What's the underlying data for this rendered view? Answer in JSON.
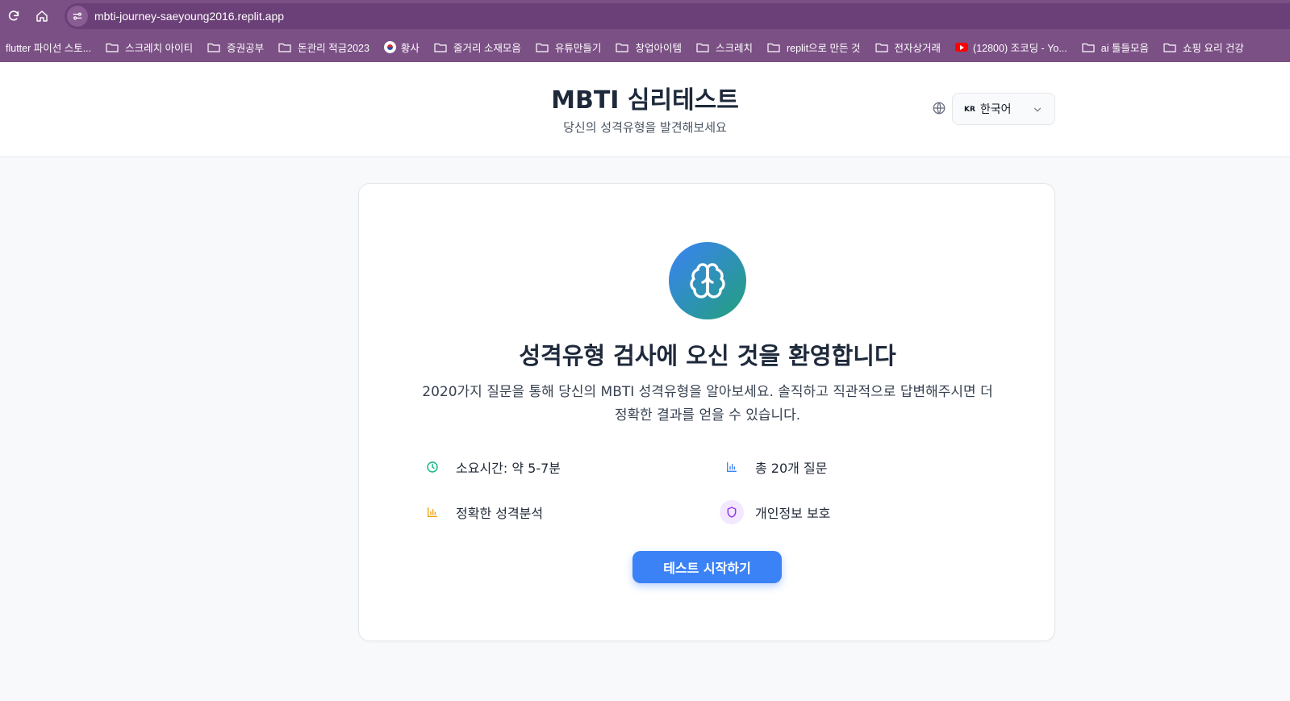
{
  "browser": {
    "url": "mbti-journey-saeyoung2016.replit.app",
    "bookmarks": [
      {
        "label": "flutter 파이선 스토...",
        "icon": "none"
      },
      {
        "label": "스크레치 아이티",
        "icon": "folder-icon"
      },
      {
        "label": "증권공부",
        "icon": "folder-icon"
      },
      {
        "label": "돈관리 적금2023",
        "icon": "folder-icon"
      },
      {
        "label": "황사",
        "icon": "korea-flag-icon"
      },
      {
        "label": "줄거리 소재모음",
        "icon": "folder-icon"
      },
      {
        "label": "유튜만들기",
        "icon": "folder-icon"
      },
      {
        "label": "창업아이템",
        "icon": "folder-icon"
      },
      {
        "label": "스크레치",
        "icon": "folder-icon"
      },
      {
        "label": "replit으로 만든 것",
        "icon": "folder-icon"
      },
      {
        "label": "전자상거래",
        "icon": "folder-icon"
      },
      {
        "label": "(12800) 조코딩 - Yo...",
        "icon": "youtube-icon"
      },
      {
        "label": "ai 툴들모음",
        "icon": "folder-icon"
      },
      {
        "label": "쇼핑 요리 건강",
        "icon": "folder-icon"
      }
    ]
  },
  "header": {
    "title": "MBTI 심리테스트",
    "subtitle": "당신의 성격유형을 발견해보세요",
    "language": {
      "code": "KR",
      "label": "한국어"
    }
  },
  "card": {
    "heading": "성격유형 검사에 오신 것을 환영합니다",
    "description": "2020가지 질문을 통해 당신의 MBTI 성격유형을 알아보세요. 솔직하고 직관적으로 답변해주시면 더 정확한 결과를 얻을 수 있습니다.",
    "features": [
      {
        "label": "소요시간: 약 5-7분",
        "icon": "clock-icon",
        "color": "#10b981"
      },
      {
        "label": "총 20개 질문",
        "icon": "bar-chart-icon",
        "color": "#3b82f6"
      },
      {
        "label": "정확한 성격분석",
        "icon": "bar-chart-icon",
        "color": "#f59e0b"
      },
      {
        "label": "개인정보 보호",
        "icon": "shield-icon",
        "color": "#9333ea"
      }
    ],
    "start_button": "테스트 시작하기"
  },
  "colors": {
    "browser_chrome": "#7b5085",
    "primary": "#3b82f6",
    "brain_gradient_start": "#3b82f6",
    "brain_gradient_end": "#22a07a"
  }
}
